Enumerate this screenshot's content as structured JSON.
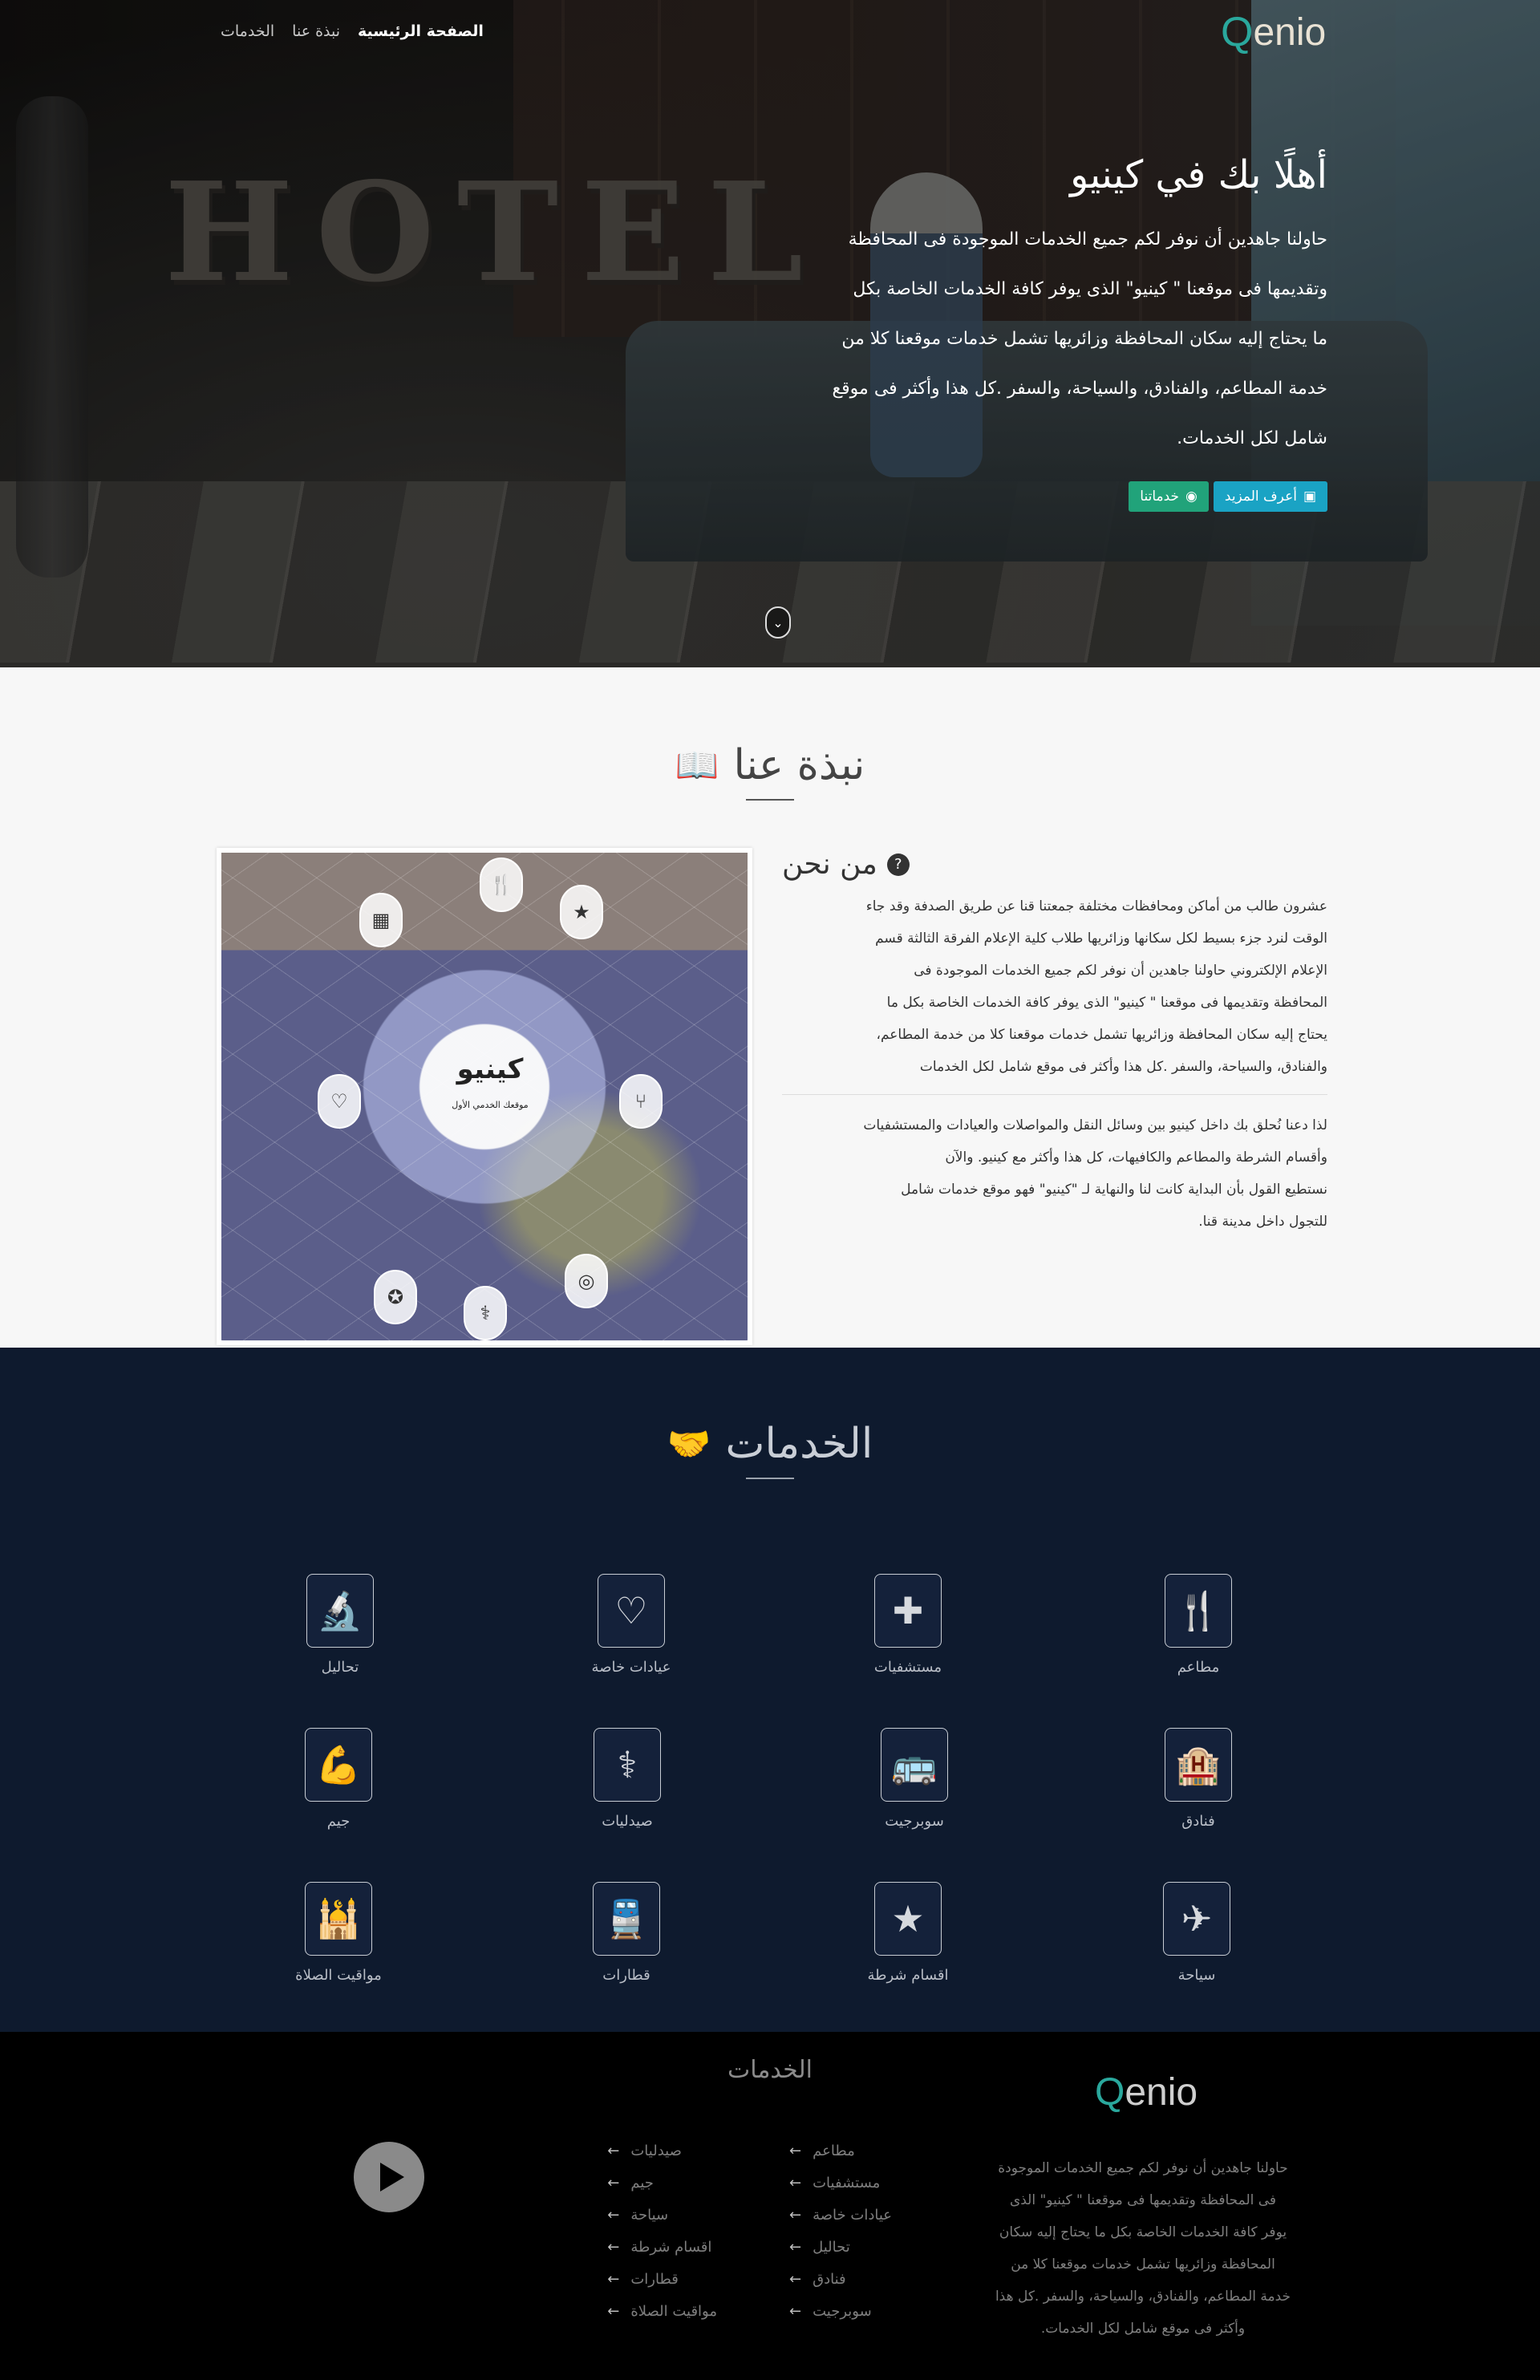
{
  "nav": {
    "items": [
      "الصفحة الرئيسية",
      "نبذة عنا",
      "الخدمات"
    ],
    "logo": "enio"
  },
  "hero": {
    "title": "أهلًا بك في كينيو",
    "lines": [
      "حاولنا جاهدين أن نوفر لكم جميع الخدمات الموجودة فى المحافظة",
      "وتقديمها فى موقعنا \" كينيو\" الذى يوفر كافة الخدمات الخاصة بكل",
      "ما يحتاج إليه سكان المحافظة وزائريها تشمل خدمات موقعنا كلا من",
      "خدمة المطاعم، والفنادق، والسياحة، والسفر .كل هذا وأكثر فى موقع",
      "شامل لكل الخدمات."
    ],
    "btn_more": "أعرف المزيد",
    "btn_services": "خدماتنا",
    "bg_word": "HOTEL"
  },
  "about": {
    "title": "نبذة عنا",
    "who_title": "من نحن",
    "image_title": "كينيو",
    "image_subtitle": "موقعك الخدمي الأول",
    "p1_lines": [
      "عشرون طالب من أماكن ومحافظات مختلفة جمعتنا قنا عن طريق الصدفة وقد جاء",
      "الوقت لنرد جزء بسيط لكل سكانها وزائريها طلاب كلية الإعلام الفرقة الثالثة قسم",
      "الإعلام الإلكتروني حاولنا جاهدين أن نوفر لكم جميع الخدمات الموجودة فى",
      "المحافظة وتقديمها فى موقعنا \" كينيو\" الذى يوفر كافة الخدمات الخاصة بكل ما",
      "يحتاج إليه سكان المحافظة وزائريها تشمل خدمات موقعنا كلا من خدمة المطاعم،",
      "والفنادق، والسياحة، والسفر .كل هذا وأكثر فى موقع شامل لكل الخدمات"
    ],
    "p2_lines": [
      "لذا دعنا نُحلق بك داخل كينيو بين وسائل النقل والمواصلات والعيادات والمستشفيات",
      "وأقسام الشرطة والمطاعم والكافيهات، كل هذا وأكثر مع كينيو. والآن",
      "نستطيع القول بأن البداية كانت لنا والنهاية لـ \"كينيو\" فهو موقع خدمات شامل",
      "للتجول داخل مدينة قنا."
    ]
  },
  "services": {
    "title": "الخدمات",
    "items": [
      {
        "label": "مطاعم",
        "icon": "🍴"
      },
      {
        "label": "مستشفيات",
        "icon": "✚"
      },
      {
        "label": "عيادات خاصة",
        "icon": "♡"
      },
      {
        "label": "تحاليل",
        "icon": "🔬"
      },
      {
        "label": "فنادق",
        "icon": "🏨"
      },
      {
        "label": "سوبرجيت",
        "icon": "🚌"
      },
      {
        "label": "صيدليات",
        "icon": "⚕"
      },
      {
        "label": "جيم",
        "icon": "💪"
      },
      {
        "label": "سياحة",
        "icon": "✈"
      },
      {
        "label": "اقسام شرطة",
        "icon": "★"
      },
      {
        "label": "قطارات",
        "icon": "🚆"
      },
      {
        "label": "مواقيت الصلاة",
        "icon": "🕌"
      }
    ]
  },
  "footer": {
    "title": "الخدمات",
    "logo": "enio",
    "desc_lines": [
      "حاولنا جاهدين أن نوفر لكم جميع الخدمات الموجودة",
      "فى المحافظة وتقديمها فى موقعنا \" كينيو\" الذى",
      "يوفر كافة الخدمات الخاصة بكل ما يحتاج إليه سكان",
      "المحافظة وزائريها تشمل خدمات موقعنا كلا من",
      "خدمة المطاعم، والفنادق، والسياحة، والسفر .كل هذا",
      "وأكثر فى موقع شامل لكل الخدمات."
    ],
    "col1": [
      "مطاعم",
      "مستشفيات",
      "عيادات خاصة",
      "تحاليل",
      "فنادق",
      "سوبرجيت"
    ],
    "col2": [
      "صيدليات",
      "جيم",
      "سياحة",
      "اقسام شرطة",
      "قطارات",
      "مواقيت الصلاة"
    ]
  }
}
